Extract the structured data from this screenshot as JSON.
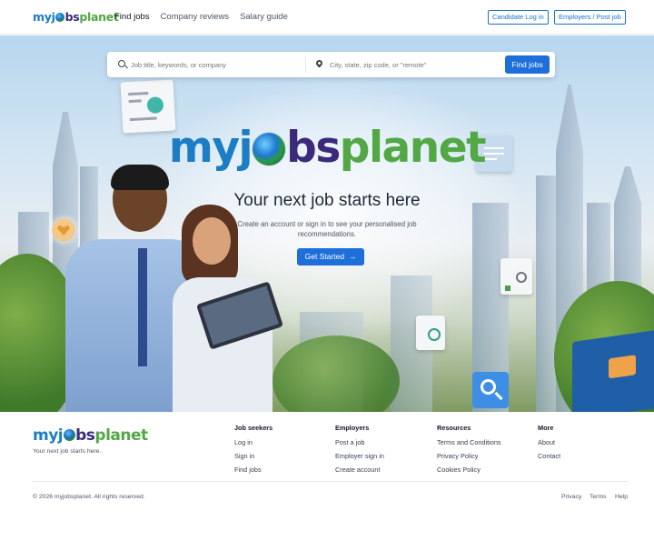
{
  "brand": {
    "my": "my",
    "j": "j",
    "bs": "bs",
    "planet": "planet"
  },
  "nav": {
    "links": [
      "Find jobs",
      "Company reviews",
      "Salary guide"
    ],
    "candidate_login": "Candidate Log in",
    "employers": "Employers / Post job"
  },
  "search": {
    "keywords_placeholder": "Job title, keywords, or company",
    "location_placeholder": "City, state, zip code, or \"remote\"",
    "button": "Find jobs"
  },
  "hero": {
    "title": "Your next job starts here",
    "subtitle": "Create an account or sign in to see your personalised job recommendations.",
    "cta": "Get Started",
    "cta_arrow": "→"
  },
  "footer": {
    "tagline": "Your next job starts here.",
    "columns": [
      {
        "heading": "Job seekers",
        "links": [
          "Log in",
          "Sign in",
          "Find jobs"
        ]
      },
      {
        "heading": "Employers",
        "links": [
          "Post a job",
          "Employer sign in",
          "Create account"
        ]
      },
      {
        "heading": "Resources",
        "links": [
          "Terms and Conditions",
          "Privacy Policy",
          "Cookies Policy"
        ]
      },
      {
        "heading": "More",
        "links": [
          "About",
          "Contact"
        ]
      }
    ],
    "copyright": "© 2026 myjobsplanet. All rights reserved.",
    "legal": [
      "Privacy",
      "Terms",
      "Help"
    ]
  },
  "colors": {
    "primary": "#1e6fd9",
    "brand_blue": "#1b7dc4",
    "brand_purple": "#3b2a7a",
    "brand_green": "#52a845"
  }
}
